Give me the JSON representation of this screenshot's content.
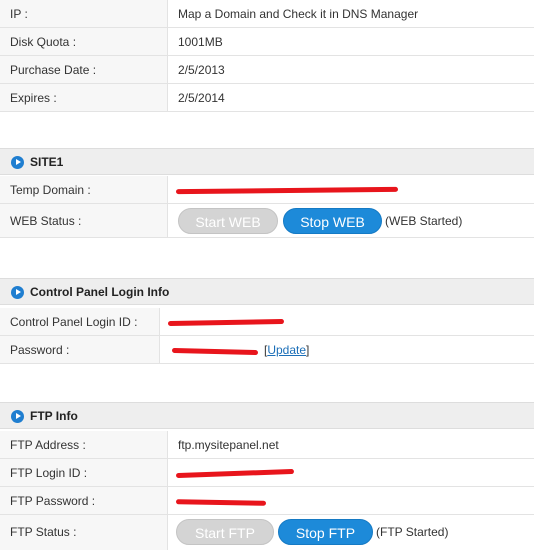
{
  "account": {
    "ip_label": "IP :",
    "ip_value": "Map a Domain and Check it in DNS Manager",
    "quota_label": "Disk Quota :",
    "quota_value": "1001MB",
    "purchase_label": "Purchase Date :",
    "purchase_value": "2/5/2013",
    "expires_label": "Expires :",
    "expires_value": "2/5/2014"
  },
  "site": {
    "title": "SITE1",
    "temp_domain_label": "Temp Domain :",
    "web_status_label": "WEB Status :",
    "start_web_label": "Start WEB",
    "stop_web_label": "Stop WEB",
    "web_status_text": "(WEB Started)"
  },
  "control_panel": {
    "title": "Control Panel Login Info",
    "login_id_label": "Control Panel Login ID :",
    "password_label": "Password :",
    "update_open": "[",
    "update_link": "Update",
    "update_close": "]"
  },
  "ftp": {
    "title": "FTP Info",
    "address_label": "FTP Address :",
    "address_value": "ftp.mysitepanel.net",
    "login_label": "FTP Login ID :",
    "password_label": "FTP Password :",
    "status_label": "FTP Status :",
    "start_ftp_label": "Start FTP",
    "stop_ftp_label": "Stop FTP",
    "ftp_status_text": "(FTP Started)"
  },
  "colors": {
    "accent": "#1d8ad9",
    "redaction": "#e8151c",
    "disabled_button": "#d4d4d4"
  }
}
